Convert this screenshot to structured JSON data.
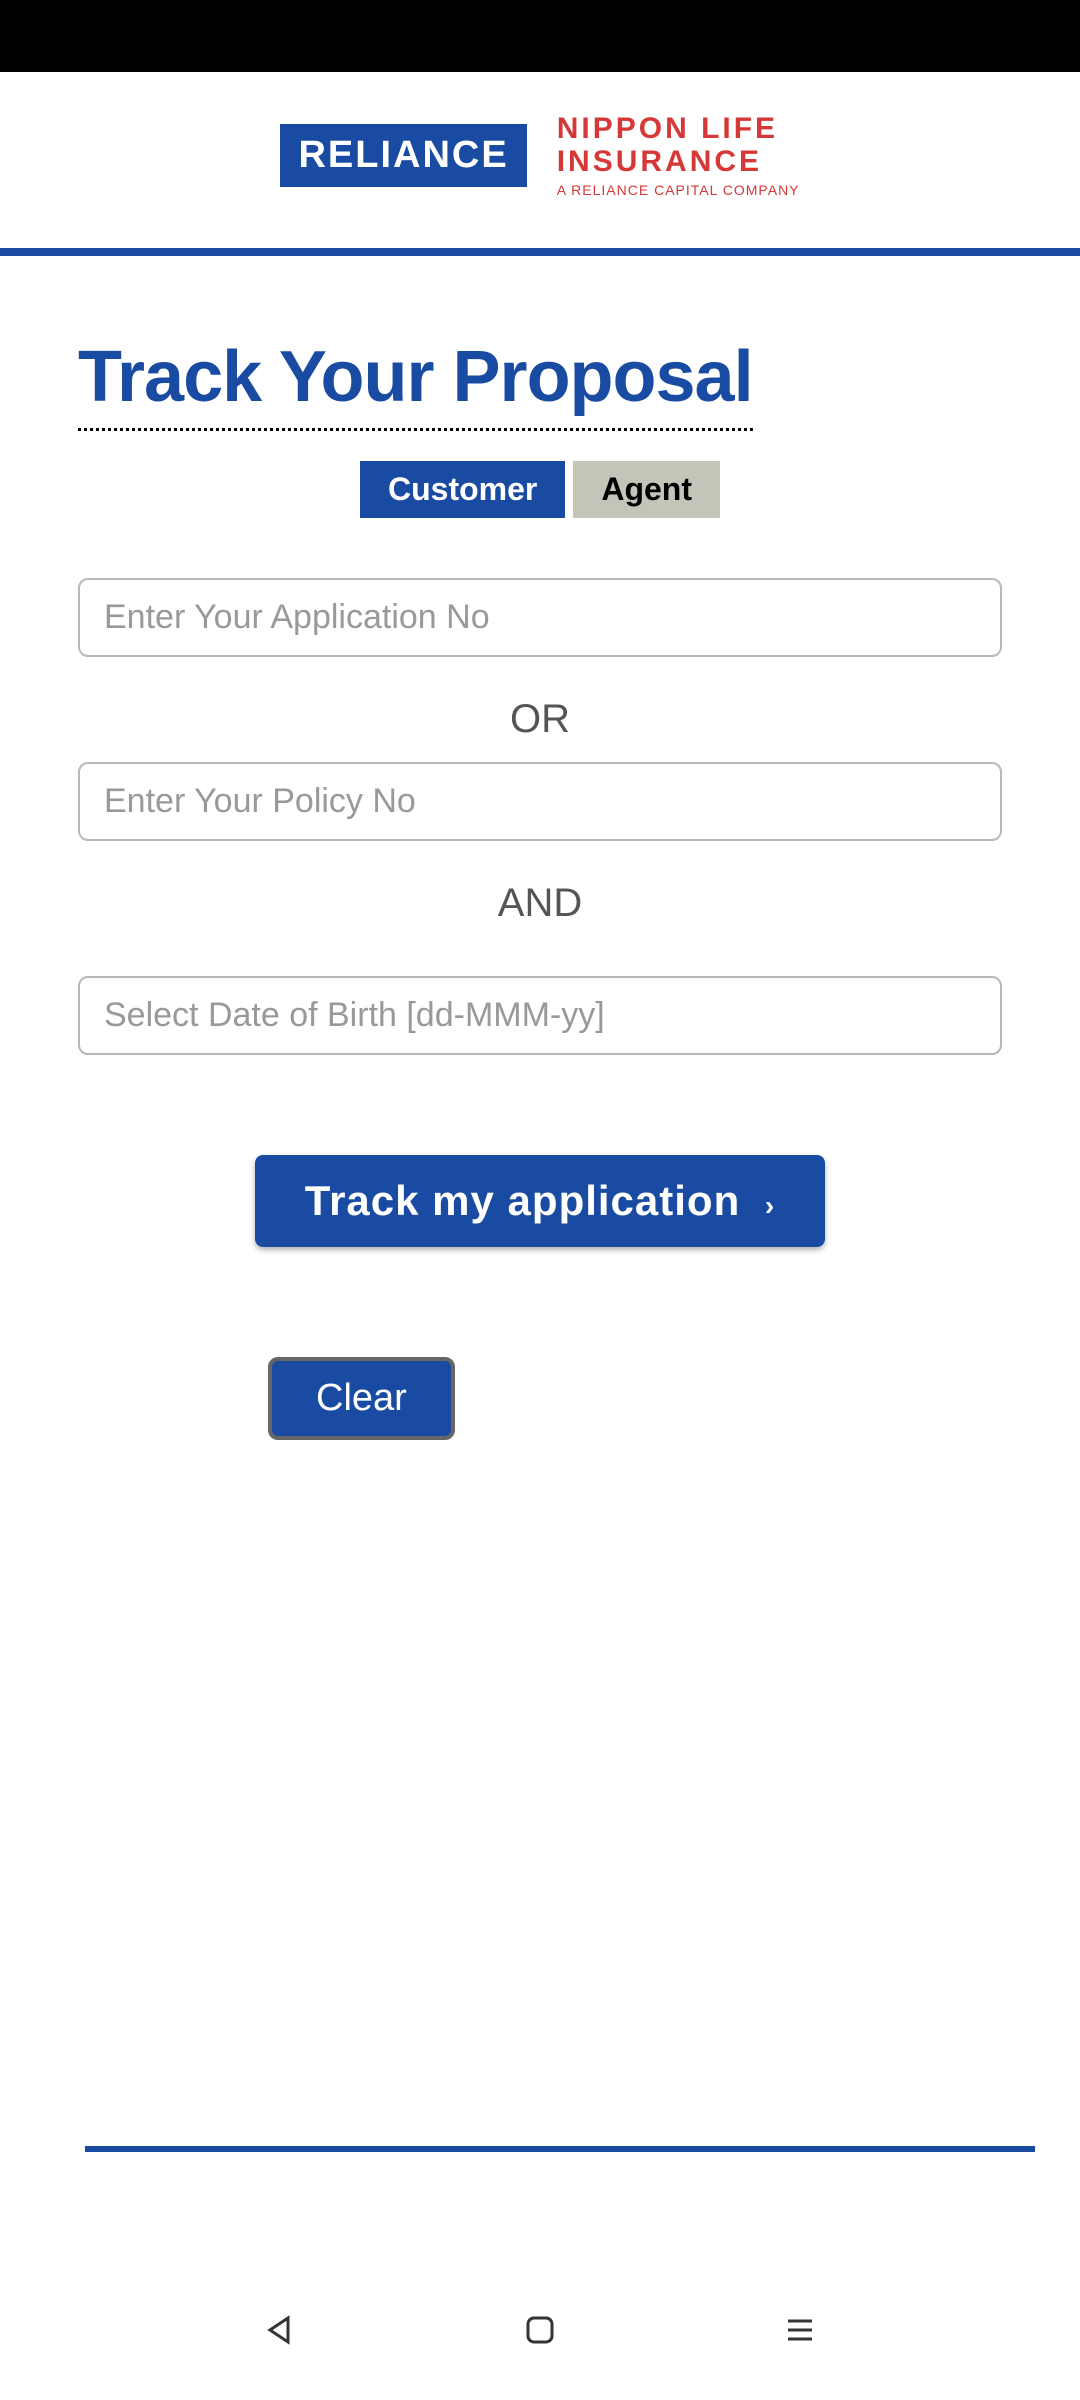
{
  "logo": {
    "reliance_text": "RELIANCE",
    "nippon_line1": "NIPPON LIFE",
    "nippon_line2": "INSURANCE",
    "nippon_subtitle": "A RELIANCE CAPITAL COMPANY"
  },
  "page_title": "Track Your Proposal",
  "tabs": {
    "customer": "Customer",
    "agent": "Agent"
  },
  "form": {
    "application_placeholder": "Enter Your Application No",
    "or_text": "OR",
    "policy_placeholder": "Enter Your Policy No",
    "and_text": "AND",
    "dob_placeholder": "Select Date of Birth [dd-MMM-yy]"
  },
  "buttons": {
    "track_label": "Track my application",
    "clear_label": "Clear"
  }
}
